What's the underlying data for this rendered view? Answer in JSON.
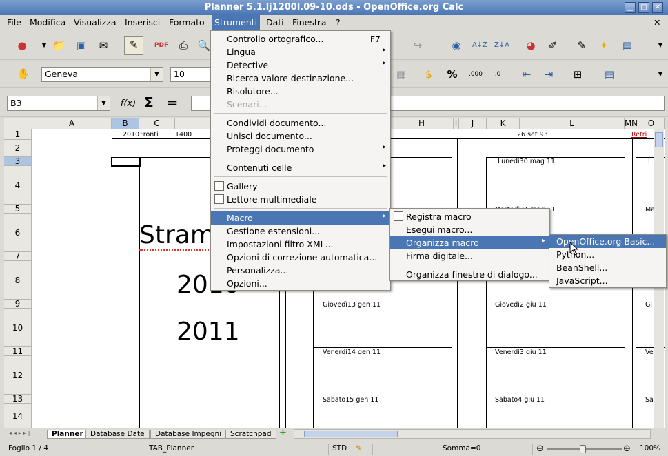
{
  "window": {
    "title": "Planner 5.1.lj1200l.09-10.ods - OpenOffice.org Calc"
  },
  "menubar": [
    "File",
    "Modifica",
    "Visualizza",
    "Inserisci",
    "Formato",
    "Strumenti",
    "Dati",
    "Finestra",
    "?"
  ],
  "format_toolbar": {
    "font_name": "Geneva",
    "font_size": "10",
    "percent_label": "%",
    "decimal_label": ".000"
  },
  "formula_bar": {
    "cell_ref": "B3",
    "fx_label": "f(x)",
    "sum_label": "Σ",
    "equals_label": "="
  },
  "sheet": {
    "columns": [
      "A",
      "B",
      "C",
      "H",
      "I",
      "J",
      "K",
      "L",
      "M",
      "N",
      "O"
    ],
    "rows": [
      "1",
      "2",
      "3",
      "4",
      "5",
      "6",
      "7",
      "8",
      "9",
      "10",
      "11",
      "12",
      "13",
      "14"
    ],
    "row1": {
      "c2010": "2010",
      "fronti": "Fronti",
      "c1400": "1400",
      "date": "26 set 93",
      "retri": "Retri"
    },
    "big_text": [
      "Stram",
      "2010",
      "2011"
    ],
    "days": [
      "Lunedì30 mag 11",
      "Martedì31 mag 11",
      "Giovedì13 gen 11",
      "Giovedì2 giu 11",
      "Venerdì14 gen 11",
      "Venerdì3 giu 11",
      "Sabato15 gen 11",
      "Sabato4 giu 11"
    ],
    "right_trunc": [
      "L",
      "Ma",
      "Gi",
      "Ve",
      "Sa"
    ]
  },
  "strumenti_menu": [
    {
      "label": "Controllo ortografico...",
      "shortcut": "F7"
    },
    {
      "label": "Lingua",
      "submenu": true
    },
    {
      "label": "Detective",
      "submenu": true
    },
    {
      "label": "Ricerca valore destinazione..."
    },
    {
      "label": "Risolutore..."
    },
    {
      "label": "Scenari...",
      "disabled": true
    },
    {
      "label": "Condividi documento..."
    },
    {
      "label": "Unisci documento..."
    },
    {
      "label": "Proteggi documento",
      "submenu": true
    },
    {
      "label": "Contenuti celle",
      "submenu": true
    },
    {
      "label": "Gallery",
      "check": true
    },
    {
      "label": "Lettore multimediale",
      "check": true
    },
    {
      "label": "Macro",
      "submenu": true,
      "selected": true
    },
    {
      "label": "Gestione estensioni..."
    },
    {
      "label": "Impostazioni filtro XML..."
    },
    {
      "label": "Opzioni di correzione automatica..."
    },
    {
      "label": "Personalizza..."
    },
    {
      "label": "Opzioni..."
    }
  ],
  "macro_menu": [
    {
      "label": "Registra macro",
      "check": true
    },
    {
      "label": "Esegui macro..."
    },
    {
      "label": "Organizza macro",
      "submenu": true,
      "selected": true
    },
    {
      "label": "Firma digitale..."
    },
    {
      "label": "Organizza finestre di dialogo..."
    }
  ],
  "organizza_menu": [
    {
      "label": "OpenOffice.org Basic...",
      "selected": true
    },
    {
      "label": "Python..."
    },
    {
      "label": "BeanShell..."
    },
    {
      "label": "JavaScript..."
    }
  ],
  "sheet_tabs": [
    "Planner",
    "Database Date",
    "Database Impegni",
    "Scratchpad"
  ],
  "statusbar": {
    "page": "Foglio 1 / 4",
    "style": "TAB_Planner",
    "mode": "STD",
    "sum": "Somma=0",
    "zoom": "100%"
  },
  "colors": {
    "accent": "#4a76b4",
    "title_gradient_top": "#7c9fcf"
  }
}
